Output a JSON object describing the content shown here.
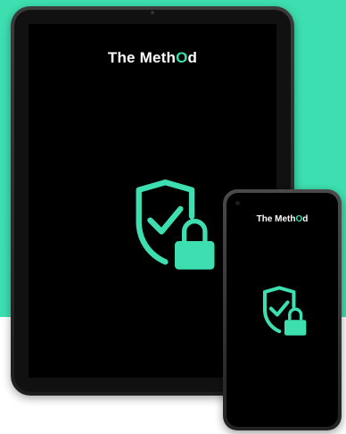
{
  "brand": {
    "text_pre": "The Meth",
    "text_o": "O",
    "text_post": "d",
    "accent_color": "#3ddfb1"
  },
  "tablet": {
    "icon": "shield-check-lock-icon"
  },
  "phone": {
    "icon": "shield-check-lock-icon"
  },
  "colors": {
    "background_teal": "#3ddfb1",
    "screen": "#000000"
  }
}
